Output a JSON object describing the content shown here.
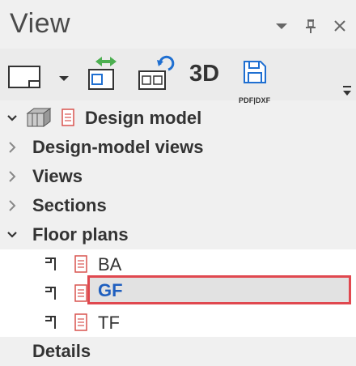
{
  "panel": {
    "title": "View",
    "controls": [
      "dropdown-icon",
      "pin-icon",
      "close-icon"
    ]
  },
  "toolbar": {
    "three_d_label": "3D",
    "pdf_dxf_label": "PDF|DXF",
    "colors": {
      "accent_green": "#4caf50",
      "accent_blue": "#1f6fd1"
    }
  },
  "tree": {
    "root": {
      "label": "Design model",
      "expanded": true
    },
    "items": [
      {
        "label": "Design-model views",
        "expanded": false
      },
      {
        "label": "Views",
        "expanded": false
      },
      {
        "label": "Sections",
        "expanded": false
      },
      {
        "label": "Floor plans",
        "expanded": true
      },
      {
        "label": "Details",
        "expanded": false
      }
    ],
    "floor_plans": [
      {
        "label": "BA",
        "selected": false
      },
      {
        "label": "GF",
        "selected": true
      },
      {
        "label": "TF",
        "selected": false
      }
    ]
  },
  "colors": {
    "selected_text": "#1f5fbf",
    "highlight_border": "#e0484f",
    "doc_icon": "#d9534f"
  }
}
